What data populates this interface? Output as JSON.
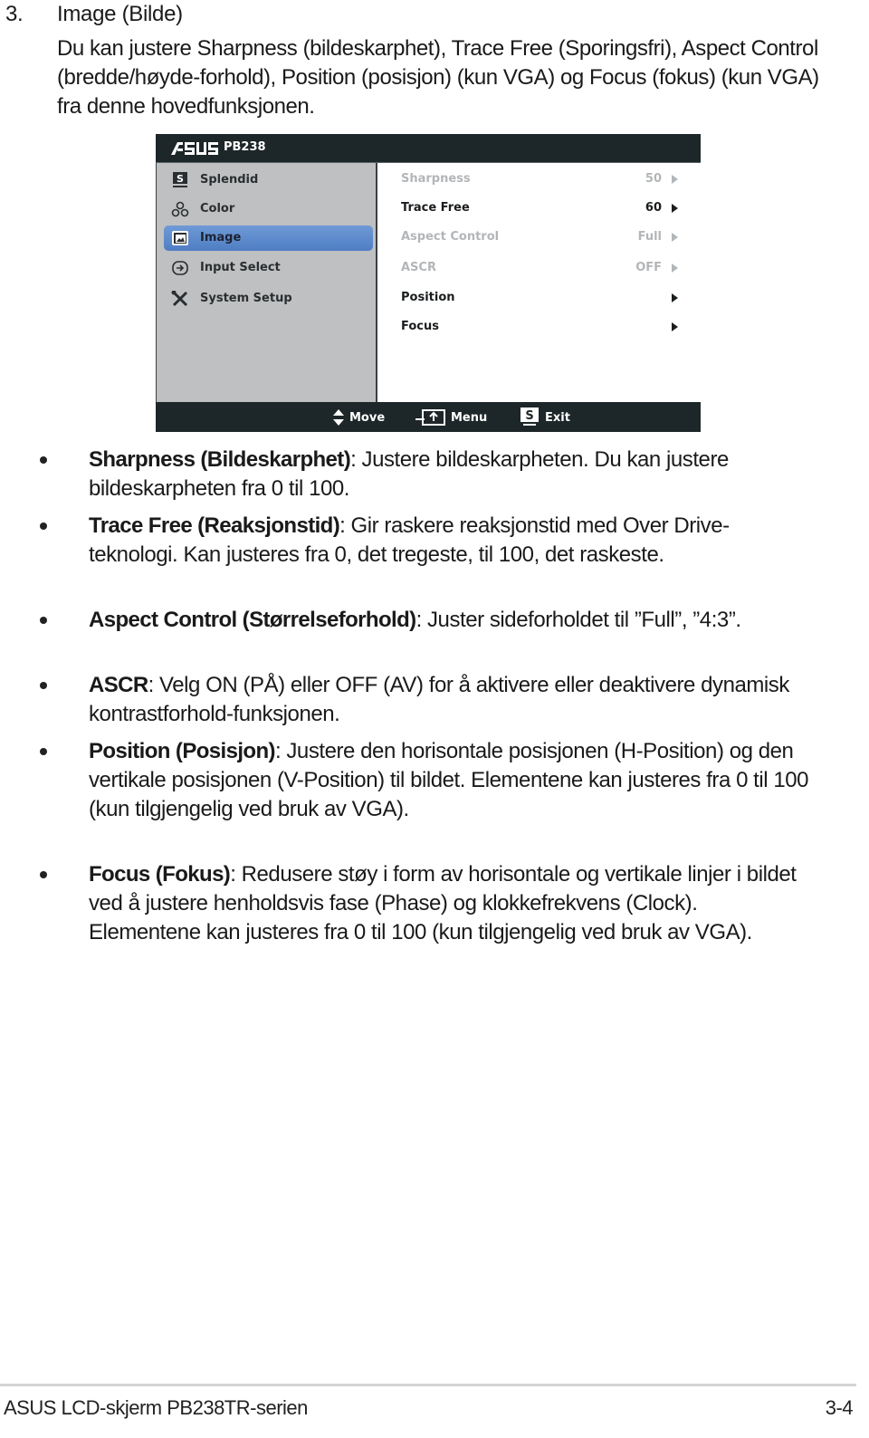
{
  "section": {
    "number": "3.",
    "title": "Image (Bilde)",
    "intro": "Du kan justere Sharpness (bildeskarphet), Trace Free (Sporingsfri), Aspect Control (bredde/høyde-forhold), Position (posisjon) (kun VGA) og Focus (fokus) (kun VGA) fra denne hovedfunksjonen."
  },
  "osd": {
    "brand": "ASUS",
    "model": "PB238",
    "menu": [
      {
        "label": "Splendid",
        "icon": "splendid-s-icon",
        "active": false
      },
      {
        "label": "Color",
        "icon": "color-circles-icon",
        "active": false
      },
      {
        "label": "Image",
        "icon": "image-picture-icon",
        "active": true
      },
      {
        "label": "Input Select",
        "icon": "input-select-icon",
        "active": false
      },
      {
        "label": "System Setup",
        "icon": "wrench-screwdriver-icon",
        "active": false
      }
    ],
    "options": [
      {
        "label": "Sharpness",
        "value": "50",
        "enabled": false
      },
      {
        "label": "Trace Free",
        "value": "60",
        "enabled": true
      },
      {
        "label": "Aspect Control",
        "value": "Full",
        "enabled": false
      },
      {
        "label": "ASCR",
        "value": "OFF",
        "enabled": false
      },
      {
        "label": "Position",
        "value": "",
        "enabled": true
      },
      {
        "label": "Focus",
        "value": "",
        "enabled": true
      }
    ],
    "footer": [
      {
        "label": "Move",
        "icon": "up-down-arrows-icon"
      },
      {
        "label": "Menu",
        "icon": "menu-return-icon"
      },
      {
        "label": "Exit",
        "icon": "exit-s-icon"
      }
    ],
    "colors": {
      "bar": "#1d2628",
      "left_panel": "#bfc0c1",
      "highlight": "#5c8ace",
      "disabled_text": "#b3b6b8"
    }
  },
  "bullets": [
    {
      "term": "Sharpness (Bildeskarphet)",
      "text": ": Justere bildeskarpheten. Du kan justere bildeskarpheten fra 0 til 100."
    },
    {
      "term": "Trace Free (Reaksjonstid)",
      "text": ": Gir raskere reaksjonstid med Over Drive-teknologi. Kan justeres fra 0, det tregeste, til 100, det raskeste."
    },
    {
      "term": "Aspect Control (Størrelseforhold)",
      "text": ": Juster sideforholdet til ”Full”, ”4:3”."
    },
    {
      "term": "ASCR",
      "text": ": Velg ON (PÅ) eller OFF (AV) for å aktivere eller deaktivere dynamisk kontrastforhold-funksjonen."
    },
    {
      "term": "Position (Posisjon)",
      "text": ": Justere den horisontale posisjonen (H-Position) og den vertikale posisjonen (V-Position) til bildet. Elementene kan justeres fra 0 til 100 (kun tilgjengelig ved bruk av VGA)."
    },
    {
      "term": "Focus (Fokus)",
      "text": ": Redusere støy i form av horisontale og vertikale linjer i bildet ved å justere henholdsvis fase (Phase) og klokkefrekvens (Clock). Elementene kan justeres fra 0 til 100 (kun tilgjengelig ved bruk av VGA)."
    }
  ],
  "footer": {
    "title": "ASUS LCD-skjerm PB238TR-serien",
    "page": "3-4"
  }
}
